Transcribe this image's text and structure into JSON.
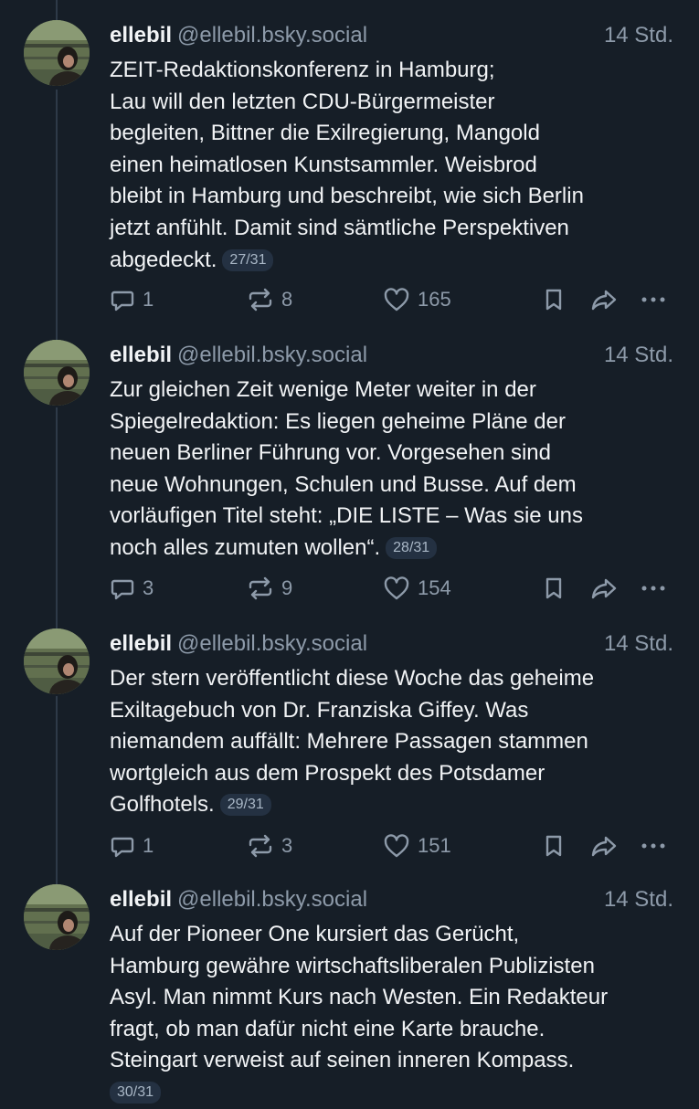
{
  "posts": [
    {
      "author": "ellebil",
      "handle": "@ellebil.bsky.social",
      "time": "14 Std.",
      "lines": [
        "ZEIT-Redaktionskonferenz in Hamburg;",
        "Lau will den letzten CDU-Bürgermeister",
        "begleiten, Bittner die Exilregierung, Mangold",
        "einen heimatlosen Kunstsammler. Weisbrod",
        "bleibt in Hamburg und beschreibt, wie sich Berlin",
        "jetzt anfühlt. Damit sind sämtliche Perspektiven",
        "abgedeckt."
      ],
      "counter": "27/31",
      "replies": "1",
      "reposts": "8",
      "likes": "165"
    },
    {
      "author": "ellebil",
      "handle": "@ellebil.bsky.social",
      "time": "14 Std.",
      "lines": [
        "Zur gleichen Zeit wenige Meter weiter in der",
        "Spiegelredaktion: Es liegen geheime Pläne der",
        "neuen Berliner Führung vor. Vorgesehen sind",
        "neue Wohnungen, Schulen und Busse. Auf dem",
        "vorläufigen Titel steht: „DIE LISTE – Was sie uns",
        "noch alles zumuten wollen“."
      ],
      "counter": "28/31",
      "replies": "3",
      "reposts": "9",
      "likes": "154"
    },
    {
      "author": "ellebil",
      "handle": "@ellebil.bsky.social",
      "time": "14 Std.",
      "lines": [
        "Der stern veröffentlicht diese Woche das geheime",
        "Exiltagebuch von Dr. Franziska Giffey. Was",
        "niemandem auffällt: Mehrere Passagen stammen",
        "wortgleich aus dem Prospekt des Potsdamer",
        "Golfhotels."
      ],
      "counter": "29/31",
      "replies": "1",
      "reposts": "3",
      "likes": "151"
    },
    {
      "author": "ellebil",
      "handle": "@ellebil.bsky.social",
      "time": "14 Std.",
      "lines": [
        "Auf der Pioneer One kursiert das Gerücht,",
        "Hamburg gewähre wirtschaftsliberalen Publizisten",
        "Asyl. Man nimmt Kurs nach Westen. Ein Redakteur",
        "fragt, ob man dafür nicht eine Karte brauche.",
        "Steingart verweist auf seinen inneren Kompass."
      ],
      "counter": "30/31"
    }
  ],
  "icons": {
    "reply": "reply-icon",
    "repost": "repost-icon",
    "like": "heart-icon",
    "bookmark": "bookmark-icon",
    "share": "share-icon",
    "more": "more-icon"
  },
  "colors": {
    "background": "#161e27",
    "text": "#f1f3f5",
    "muted": "#8d9aa9",
    "badge": "#243142"
  }
}
